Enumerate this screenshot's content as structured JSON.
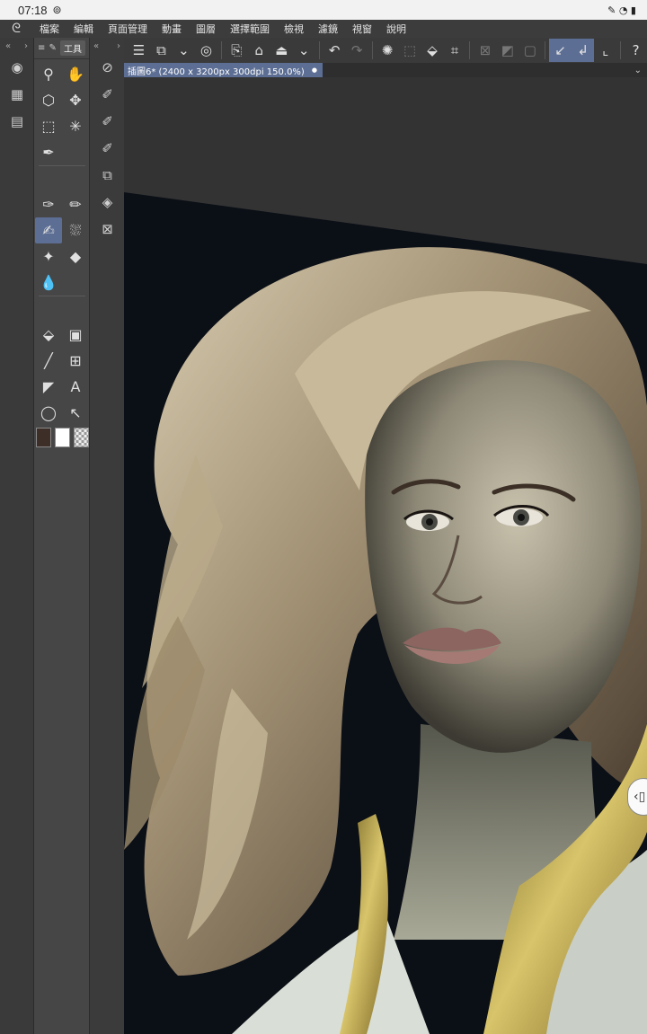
{
  "statusbar": {
    "time": "07:18",
    "sync_icon": "⊚",
    "right_icons": "✎ ◔ ▮"
  },
  "menu": {
    "logo_icon": "clip-studio-logo-icon",
    "items": [
      "檔案",
      "編輯",
      "頁面管理",
      "動畫",
      "圖層",
      "選擇範圍",
      "檢視",
      "濾鏡",
      "視窗",
      "說明"
    ]
  },
  "palette": {
    "tab_label": "工具"
  },
  "document": {
    "tab_title": "插圖6* (2400 x 3200px 300dpi 150.0%)",
    "tab_dot": "●"
  },
  "colors": {
    "main_color": "#3d2e28",
    "sub_color": "#ffffff",
    "selected_accent": "#5c6e94"
  }
}
